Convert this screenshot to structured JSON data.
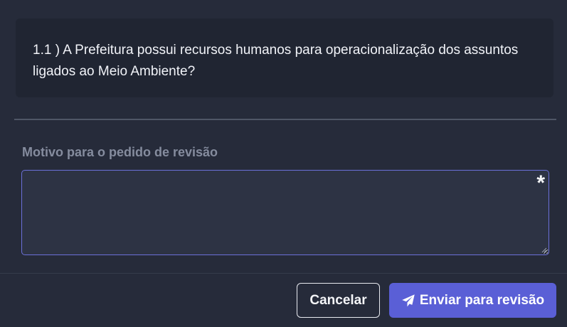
{
  "question": {
    "text": "1.1 ) A Prefeitura possui recursos humanos para operacionalização dos assuntos ligados ao Meio Ambiente?"
  },
  "form": {
    "reason_label": "Motivo para o pedido de revisão",
    "reason_value": "",
    "required_mark": "*"
  },
  "footer": {
    "cancel_label": "Cancelar",
    "submit_label": "Enviar para revisão",
    "submit_icon": "paper-plane-icon"
  },
  "colors": {
    "background": "#262b3a",
    "accent": "#5a5fd6"
  }
}
